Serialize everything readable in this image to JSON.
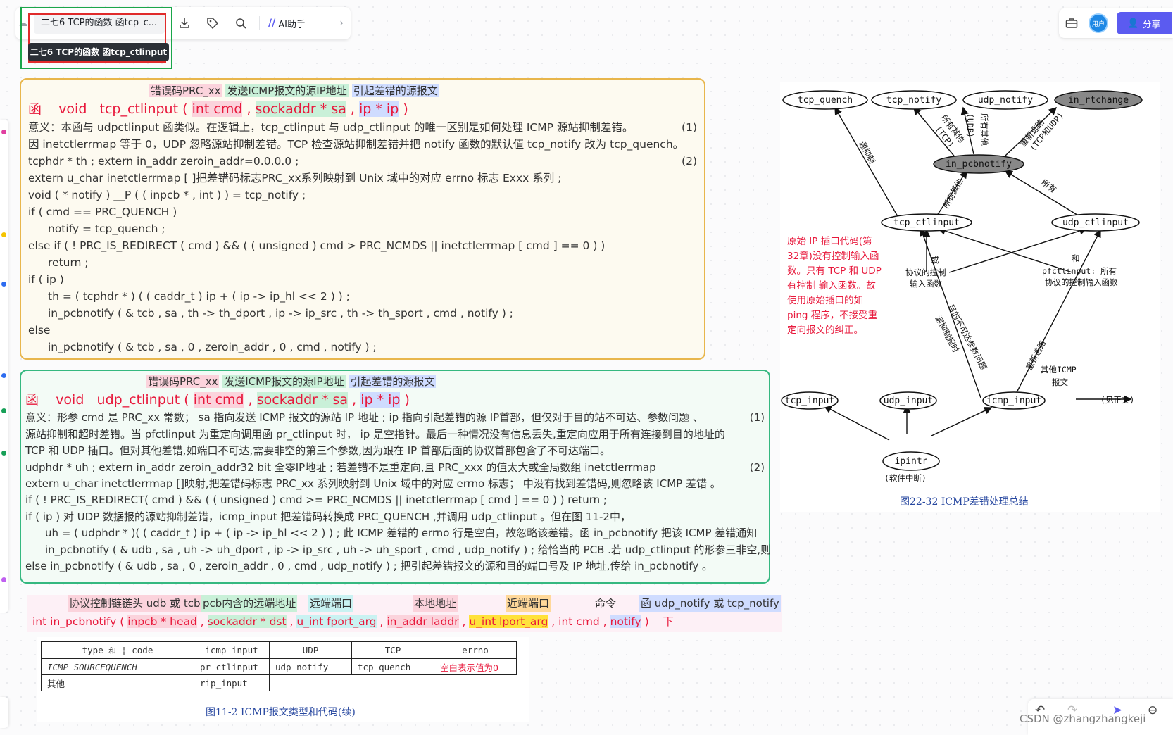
{
  "toolbar": {
    "doc_title": "二七6 TCP的函数 函tcp_c...",
    "tooltip": "二七6 TCP的函数 函tcp_ctlinput",
    "ai_label": "AI助手"
  },
  "topright": {
    "avatar_label": "用户",
    "share_label": "分享"
  },
  "panel1": {
    "labels": [
      "错误码PRC_xx",
      "发送ICMP报文的源IP地址",
      "引起差错的源报文"
    ],
    "func": {
      "prefix": "函",
      "ret": "void",
      "name": "tcp_ctlinput",
      "open": "(",
      "p1": "int cmd",
      "c1": ",",
      "p2": "sockaddr * sa",
      "c2": ",",
      "p3": "ip * ip",
      "close": ")"
    },
    "lines": [
      "意义：本函与 udpctlinput 函类似。在逻辑上，tcp_ctlinput 与 udp_ctlinput 的唯一区别是如何处理 ICMP 源站抑制差错。",
      "因 inetctlerrmap 等于 0，UDP 忽略源站抑制差错。TCP 检查源站抑制差错并把 notify 函数的默认值 tcp_notify 改为 tcp_quench。",
      "tcphdr * th ;      extern in_addr  zeroin_addr=0.0.0.0 ;",
      "extern  u_char  inetctlerrmap [ ]把差错码标志PRC_xx系列映射到 Unix 域中的对应 errno 标志 Exxx 系列 ;",
      "void  ( * notify )  __P ( ( inpcb * , int ) )  =  tcp_notify ;",
      "if ( cmd  ==  PRC_QUENCH )",
      "notify  =  tcp_quench ;",
      "else  if  ( ! PRC_IS_REDIRECT ( cmd )  &&  ( ( unsigned ) cmd  >  PRC_NCMDS  ||  inetctlerrmap [ cmd ]  ==  0 ) )",
      "return ;",
      "if ( ip )",
      "th  =  ( tcphdr * ) ( ( caddr_t ) ip  +  ( ip -> ip_hl  <<  2 ) ) ;",
      "in_pcbnotify ( & tcb ,  sa ,  th -> th_dport , ip -> ip_src , th -> th_sport ,  cmd , notify ) ;",
      "else",
      "in_pcbnotify ( & tcb , sa , 0 , zeroin_addr , 0 , cmd , notify ) ;"
    ],
    "nums": [
      "(1)",
      "(2)"
    ]
  },
  "panel2": {
    "labels": [
      "错误码PRC_xx",
      "发送ICMP报文的源IP地址",
      "引起差错的源报文"
    ],
    "func": {
      "prefix": "函",
      "ret": "void",
      "name": "udp_ctlinput",
      "open": "(",
      "p1": "int cmd",
      "c1": ",",
      "p2": "sockaddr * sa",
      "c2": ",",
      "p3": "ip * ip",
      "close": ")"
    },
    "lines": [
      "意义：形参 cmd 是 PRC_xx 常数； sa 指向发送 ICMP 报文的源站 IP 地址 ; ip 指向引起差错的源 IP首部，但仅对于目的站不可达、参数问题 、",
      "源站抑制和超时差错。当 pfctlinput 为重定向调用函 pr_ctlinput 时， ip 是空指针。最后一种情况没有信息丢失,重定向应用于所有连接到目的地址的",
      "TCP 和 UDP 插口。但对其他差错,如端口不可达,需要非空的第三个参数,因为跟在 IP 首部后面的协议首部包含了不可达端口。",
      "udphdr  * uh ;       extern   in_addr   zeroin_addr32 bit 全零IP地址 ;         若差错不是重定向,且 PRC_xxx 的值太大或全局数组 inetctlerrmap",
      "extern  u_char   inetctlerrmap []映射,把差错码标志 PRC_xx 系列映射到 Unix 域中的对应 errno 标志；  中没有找到差错码,则忽略该 ICMP 差错 。",
      "if ( ! PRC_IS_REDIRECT( cmd ) && ( ( unsigned ) cmd  >=  PRC_NCMDS  ||  inetctlerrmap [ cmd ]  ==  0 ) )           return ;",
      "if ( ip )                        对 UDP 数据报的源站抑制差错，icmp_input 把差错码转换成 PRC_QUENCH ,并调用 udp_ctlinput 。但在图 11-2中，",
      "uh  =  ( udphdr * )( ( caddr_t ) ip  +  ( ip -> ip_hl  <<  2 ) ) ;   此 ICMP 差错的 errno 行是空白，故忽略该差错。函 in_pcbnotify 把该 ICMP 差错通知",
      "in_pcbnotify  ( & udb  , sa , uh -> uh_dport , ip -> ip_src , uh -> uh_sport ,  cmd , udp_notify ) ;  给恰当的 PCB .若 udp_ctlinput 的形参三非空,则",
      "else     in_pcbnotify ( & udb , sa , 0 , zeroin_addr , 0 , cmd , udp_notify ) ;             把引起差错报文的源和目的端口号及 IP 地址,传给 in_pcbnotify 。"
    ],
    "nums": [
      "(1)",
      "(2)"
    ]
  },
  "strip": {
    "labels": [
      "协议控制链链头 udb 或 tcb",
      "pcb内含的远端地址",
      "远端端口",
      "本地地址",
      "近端端口",
      "命令",
      "函 udp_notify 或 tcp_notify"
    ],
    "pre": "int in_pcbnotify (",
    "args": [
      "inpcb * head",
      "sockaddr * dst",
      "u_int  fport_arg",
      "in_addr  laddr",
      "u_int  lport_arg",
      "int  cmd",
      "notify"
    ],
    "seps": [
      ",",
      ",",
      ",",
      ",",
      ",",
      ","
    ],
    "post": ")",
    "suffix": "下"
  },
  "table": {
    "headers": [
      "type",
      "和",
      "code",
      "icmp_input",
      "UDP",
      "TCP",
      "errno"
    ],
    "row1": [
      "ICMP_SOURCEQUENCH",
      "pr_ctlinput",
      "udp_notify",
      "tcp_quench",
      "空白表示值为0"
    ],
    "row2": [
      "其他",
      "rip_input"
    ],
    "caption": "图11-2   ICMP报文类型和代码(续)"
  },
  "diagram": {
    "nodes": [
      "tcp_quench",
      "tcp_notify",
      "udp_notify",
      "in_rtchange",
      "in_pcbnotify",
      "tcp_ctlinput",
      "udp_ctlinput",
      "tcp_input",
      "udp_input",
      "icmp_input",
      "ipintr"
    ],
    "edge_labels": [
      "源抑制",
      "所有其他",
      "(TCP)",
      "(UDP)",
      "所有其他",
      "重新选路",
      "(TCP和UDP)",
      "所有其他",
      "所有",
      "或",
      "协议的控制",
      "输入函数",
      "和",
      "pfctlinput: 所有",
      "协议的控制输入函数",
      "目的不可达参数问题",
      "源抑制超时",
      "重新选路",
      "其他ICMP",
      "报文",
      "(见正文)",
      "(软件中断)"
    ],
    "annotation": "原始 IP 插口代码(第32章)没有控制输入函数。只有 TCP 和 UDP 有控制 输入函数。故使用原始插口的如 ping 程序，不接受重定向报文的纠正。",
    "caption": "图22-32   ICMP差错处理总结"
  },
  "watermark": "CSDN @zhangzhangkeji",
  "colors": {
    "accent": "#5b5bf0",
    "panel1_border": "#e8b64c",
    "panel2_border": "#35b880",
    "red": "#e8193c"
  }
}
